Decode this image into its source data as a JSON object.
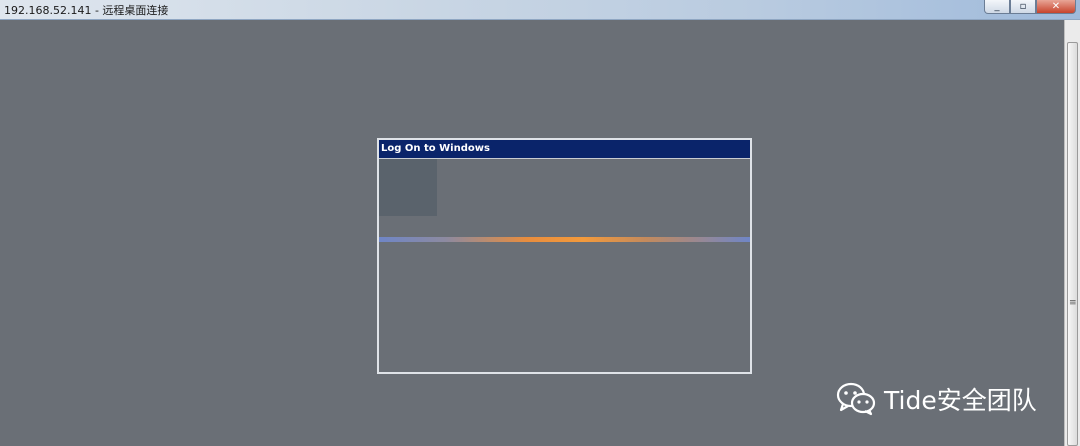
{
  "window": {
    "title": "192.168.52.141 - 远程桌面连接",
    "controls": {
      "minimize": "_",
      "restore": "▫",
      "close": "✕"
    }
  },
  "dialog": {
    "title": "Log On to Windows"
  },
  "watermark": {
    "text": "Tide安全团队",
    "icon": "wechat-icon"
  },
  "scrollbar": {
    "grip": "≡"
  },
  "colors": {
    "desktop": "#6a6f76",
    "dialog_title_bg": "#0a246a",
    "brand_bar_orange": "#f39a3c",
    "brand_bar_blue": "#6f86c7"
  }
}
